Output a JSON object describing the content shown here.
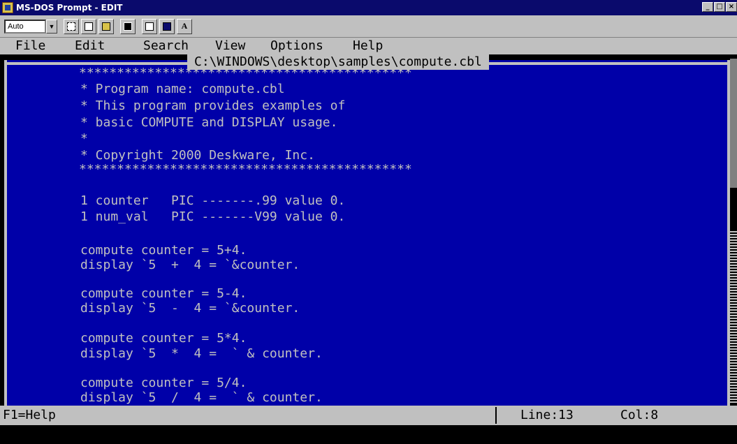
{
  "window": {
    "title": "MS-DOS Prompt - EDIT",
    "buttons": [
      "_",
      "□",
      "×"
    ]
  },
  "toolbar": {
    "font_size": "Auto",
    "font_button_label": "A"
  },
  "menu": [
    "File",
    "Edit",
    "Search",
    "View",
    "Options",
    "Help"
  ],
  "editor": {
    "filename": "C:\\WINDOWS\\desktop\\samples\\compute.cbl",
    "lines": [
      "********************************************",
      "* Program name: compute.cbl",
      "* This program provides examples of",
      "* basic COMPUTE and DISPLAY usage.",
      "*",
      "* Copyright 2000 Deskware, Inc.",
      "********************************************",
      "",
      "",
      "1 counter   PIC -------.99 value 0.",
      "1 num_val   PIC -------V99 value 0.",
      "",
      "compute counter = 5+4.",
      "display `5  +  4 = `&counter.",
      "",
      "compute counter = 5-4.",
      "display `5  -  4 = `&counter.",
      "",
      "compute counter = 5*4.",
      "display `5  *  4 =  ` & counter.",
      "",
      "compute counter = 5/4.",
      "display `5  /  4 =  ` & counter."
    ]
  },
  "status": {
    "help": "F1=Help",
    "line": "Line:13",
    "col": "Col:8"
  },
  "colors": {
    "editor_bg": "#0000a8",
    "text": "#c0c0c0",
    "titlebar": "#0a0a6c"
  }
}
